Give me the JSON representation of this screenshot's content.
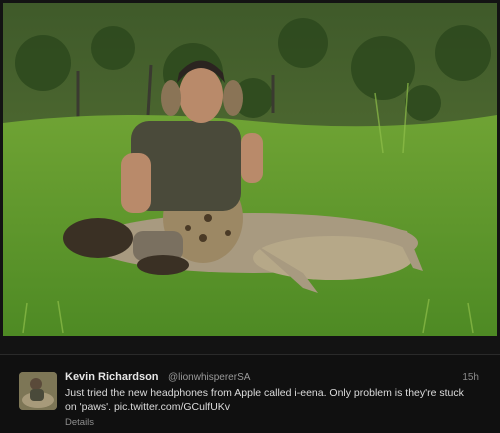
{
  "tweet": {
    "author_name": "Kevin Richardson",
    "handle": "@lionwhispererSA",
    "timestamp": "15h",
    "text": "Just tried the new headphones from Apple called i-eena. Only problem is they're stuck on 'paws'. pic.twitter.com/GCulfUKv",
    "details_label": "Details"
  },
  "icons": {
    "photo": "man-with-hyena-photo",
    "avatar": "profile-avatar"
  }
}
